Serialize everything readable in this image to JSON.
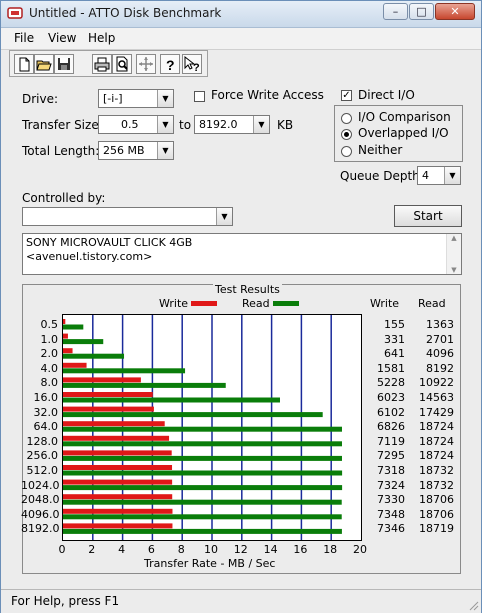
{
  "window": {
    "title": "Untitled - ATTO Disk Benchmark"
  },
  "titlebar_buttons": {
    "minimize": "–",
    "maximize": "□",
    "close": "✕"
  },
  "menu": [
    "File",
    "View",
    "Help"
  ],
  "toolbar": {
    "icons": [
      "new-icon",
      "open-icon",
      "save-icon",
      "print-icon",
      "print-preview-icon",
      "move-icon",
      "help-icon",
      "context-help-icon"
    ]
  },
  "form": {
    "drive_label": "Drive:",
    "drive_value": "[-i-]",
    "force_write_label": "Force Write Access",
    "direct_io_label": "Direct I/O",
    "direct_io_checked": true,
    "transfer_size_label": "Transfer Size:",
    "transfer_from": "0.5",
    "to_label": "to",
    "transfer_to": "8192.0",
    "kb_label": "KB",
    "total_length_label": "Total Length:",
    "total_length_value": "256 MB",
    "io_comparison_label": "I/O Comparison",
    "overlapped_io_label": "Overlapped I/O",
    "neither_label": "Neither",
    "queue_depth_label": "Queue Depth:",
    "queue_depth_value": "4",
    "controlled_by_label": "Controlled by:",
    "controlled_by_value": "",
    "start_button": "Start",
    "description_line1": "SONY MICROVAULT CLICK 4GB",
    "description_line2": "<avenuel.tistory.com>"
  },
  "results": {
    "title": "Test Results",
    "write_legend": "Write",
    "read_legend": "Read",
    "write_header": "Write",
    "read_header": "Read",
    "write_color": "#e01818",
    "read_color": "#0a7d0a",
    "grid_color": "#1a2a9a"
  },
  "chart_data": {
    "type": "bar",
    "orientation": "horizontal",
    "categories": [
      "0.5",
      "1.0",
      "2.0",
      "4.0",
      "8.0",
      "16.0",
      "32.0",
      "64.0",
      "128.0",
      "256.0",
      "512.0",
      "1024.0",
      "2048.0",
      "4096.0",
      "8192.0"
    ],
    "series": [
      {
        "name": "Write",
        "values": [
          155,
          331,
          641,
          1581,
          5228,
          6023,
          6102,
          6826,
          7119,
          7295,
          7318,
          7324,
          7330,
          7348,
          7346
        ]
      },
      {
        "name": "Read",
        "values": [
          1363,
          2701,
          4096,
          8192,
          10922,
          14563,
          17429,
          18724,
          18724,
          18724,
          18732,
          18732,
          18706,
          18706,
          18719
        ]
      }
    ],
    "x_ticks": [
      "0",
      "2",
      "4",
      "6",
      "8",
      "10",
      "12",
      "14",
      "16",
      "18",
      "20"
    ],
    "xlabel": "Transfer Rate - MB / Sec",
    "xlim": [
      0,
      20
    ]
  },
  "status": {
    "text": "For Help, press F1"
  }
}
